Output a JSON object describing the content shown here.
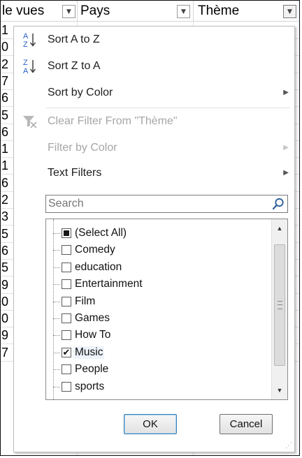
{
  "header": {
    "col1_label": "le vues",
    "col2_label": "Pays",
    "col3_label": "Thème"
  },
  "left_column_digits": [
    "1",
    "0",
    "2",
    "7",
    "6",
    "5",
    "6",
    "1",
    "1",
    "6",
    "2",
    "3",
    "5",
    "6",
    "5",
    "9",
    "0",
    "0",
    "9",
    "7"
  ],
  "menu": {
    "sort_az": "Sort A to Z",
    "sort_za": "Sort Z to A",
    "sort_by_color": "Sort by Color",
    "clear_filter": "Clear Filter From \"Thème\"",
    "filter_by_color": "Filter by Color",
    "text_filters": "Text Filters"
  },
  "search": {
    "placeholder": "Search"
  },
  "list": {
    "items": [
      {
        "label": "(Select All)",
        "state": "partial"
      },
      {
        "label": "Comedy",
        "state": "unchecked"
      },
      {
        "label": "education",
        "state": "unchecked"
      },
      {
        "label": "Entertainment",
        "state": "unchecked"
      },
      {
        "label": "Film",
        "state": "unchecked"
      },
      {
        "label": "Games",
        "state": "unchecked"
      },
      {
        "label": "How To",
        "state": "unchecked"
      },
      {
        "label": "Music",
        "state": "checked"
      },
      {
        "label": "People",
        "state": "unchecked"
      },
      {
        "label": "sports",
        "state": "unchecked"
      }
    ]
  },
  "buttons": {
    "ok": "OK",
    "cancel": "Cancel"
  },
  "icons": {
    "sort_az": "sort-ascending-icon",
    "sort_za": "sort-descending-icon",
    "clear_filter": "clear-filter-icon",
    "search": "magnifier-icon"
  },
  "colors": {
    "sort_letter_blue": "#2a62c9",
    "ok_border": "#3c7fb1",
    "disabled_text": "#a6a6a6"
  }
}
